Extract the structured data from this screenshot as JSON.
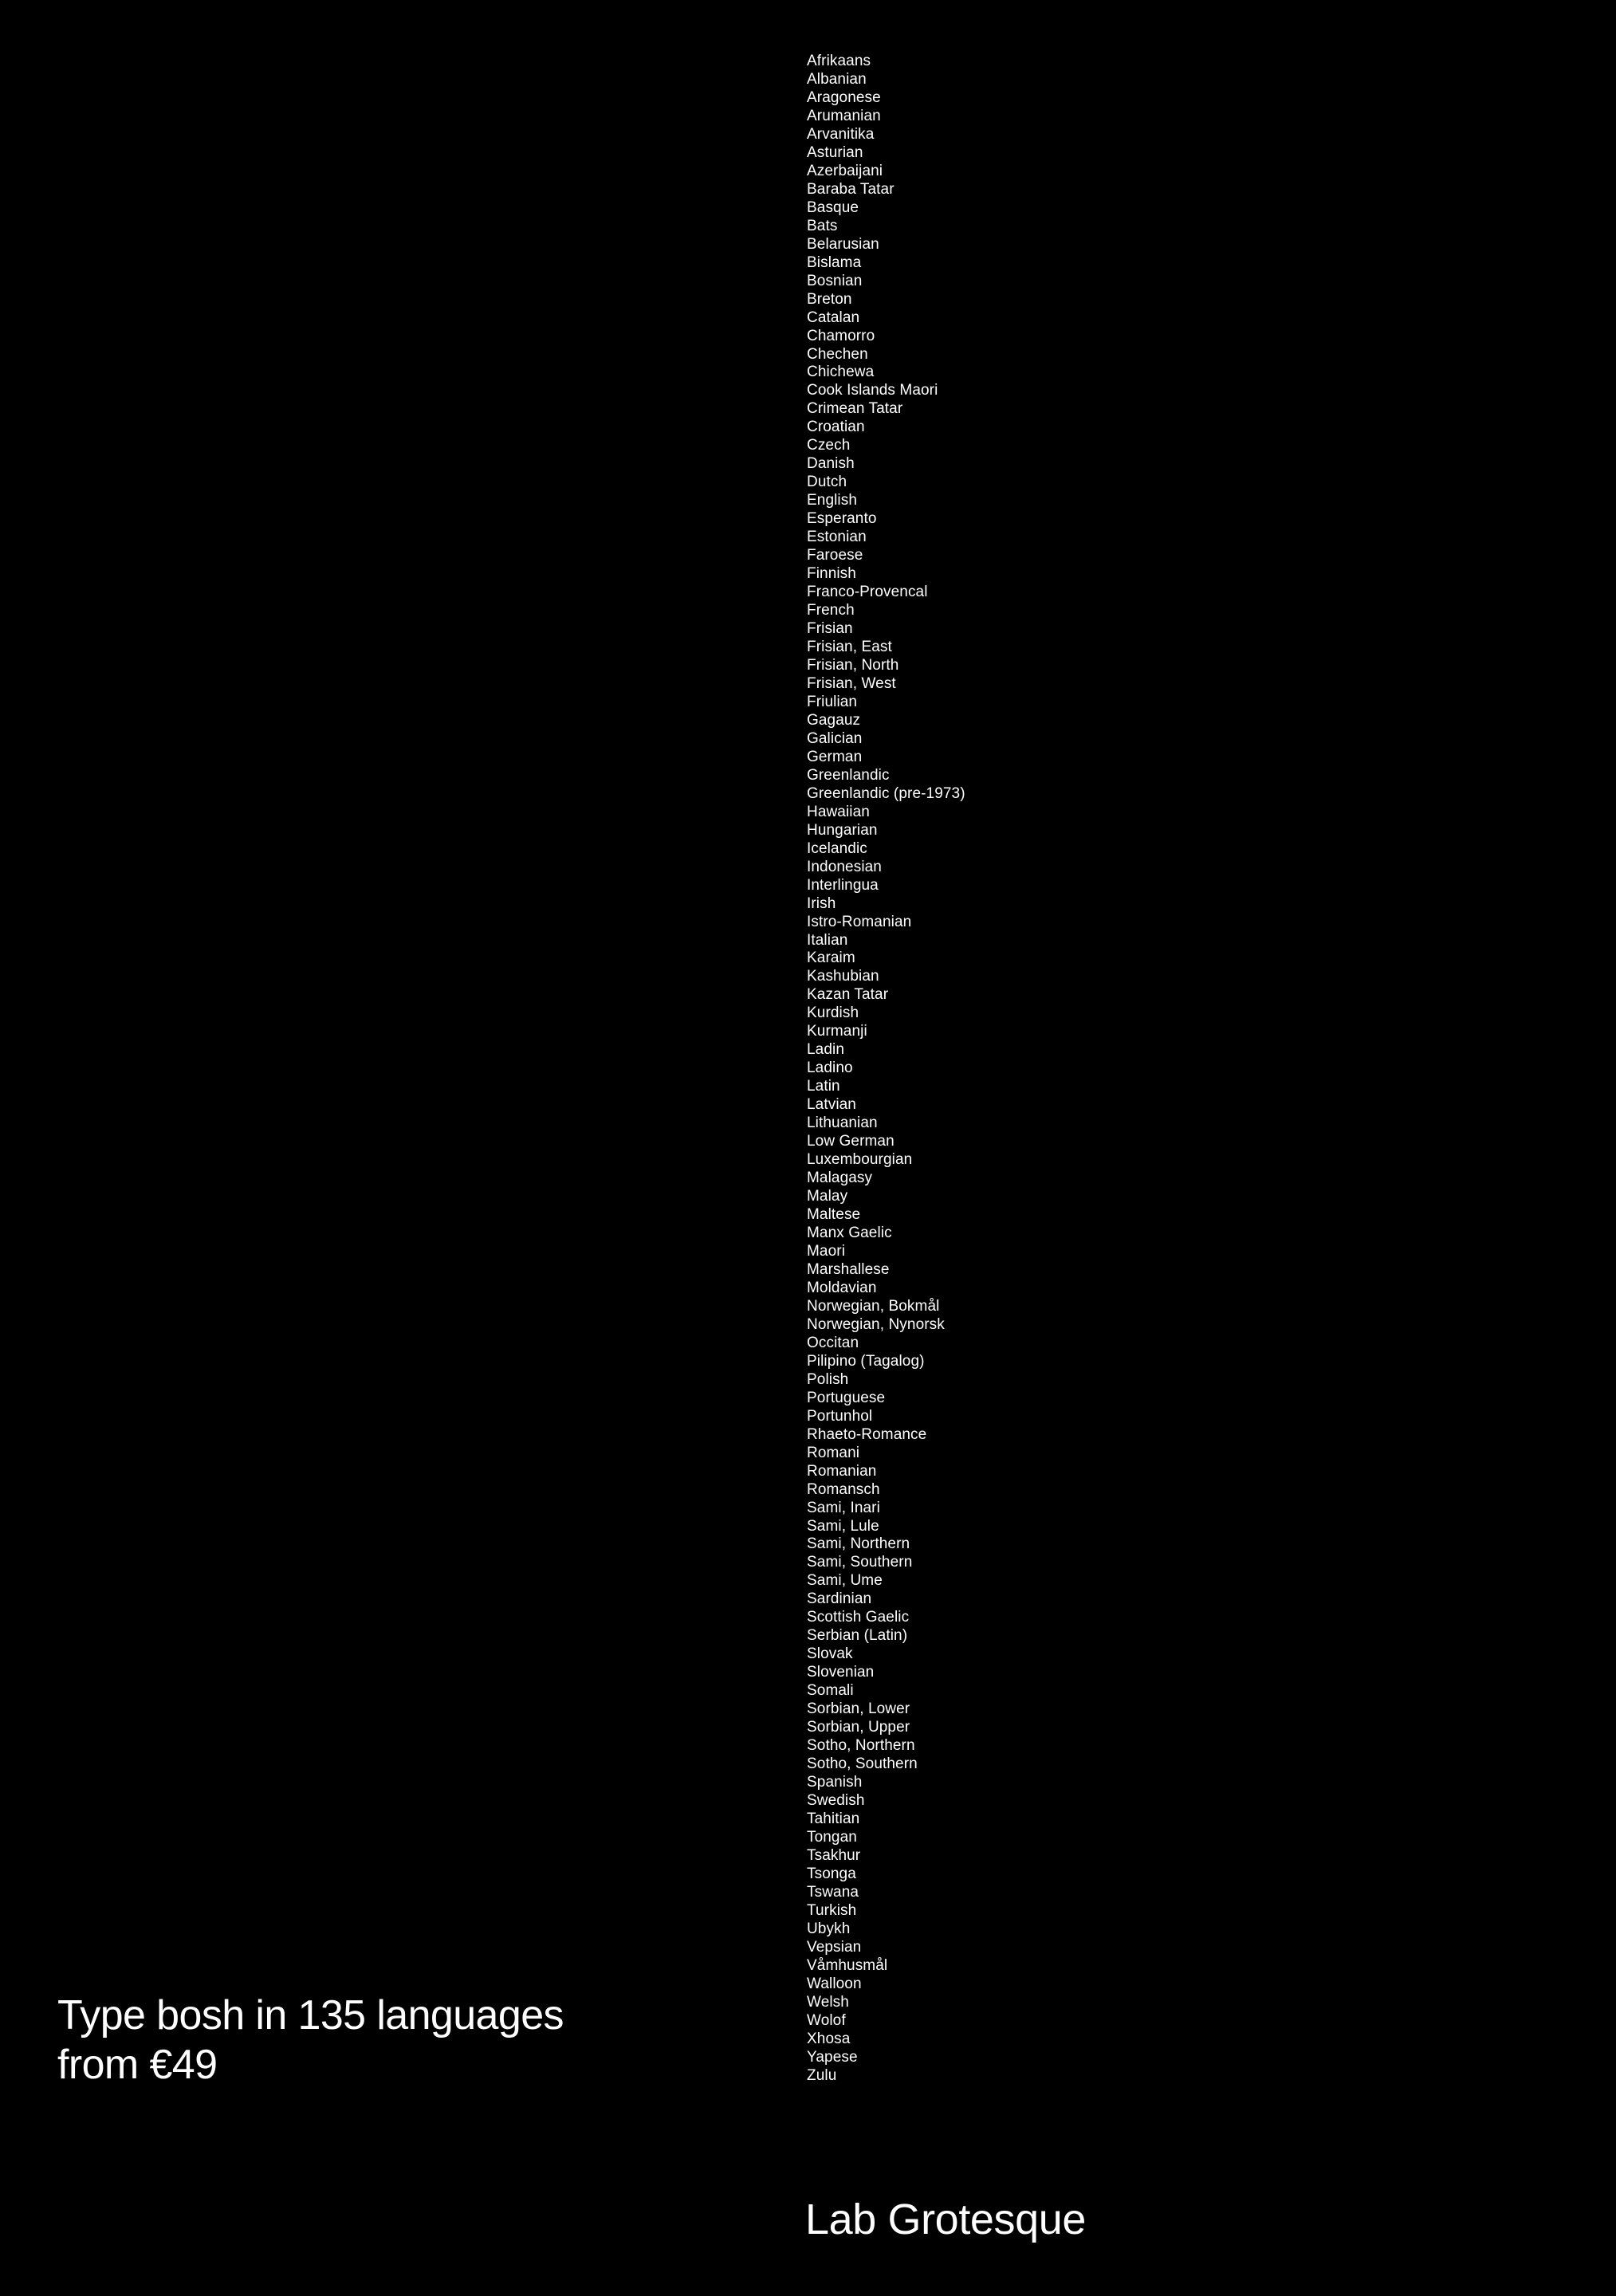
{
  "colors": {
    "background": "#000000",
    "text": "#ffffff"
  },
  "headline": {
    "line1": "Type bosh in 135 languages",
    "line2": "from €49"
  },
  "brand": {
    "name": "Lab Grotesque"
  },
  "languages": [
    "Afrikaans",
    "Albanian",
    "Aragonese",
    "Arumanian",
    "Arvanitika",
    "Asturian",
    "Azerbaijani",
    "Baraba Tatar",
    "Basque",
    "Bats",
    "Belarusian",
    "Bislama",
    "Bosnian",
    "Breton",
    "Catalan",
    "Chamorro",
    "Chechen",
    "Chichewa",
    "Cook Islands Maori",
    "Crimean Tatar",
    "Croatian",
    "Czech",
    "Danish",
    "Dutch",
    "English",
    "Esperanto",
    "Estonian",
    "Faroese",
    "Finnish",
    "Franco-Provencal",
    "French",
    "Frisian",
    "Frisian, East",
    "Frisian, North",
    "Frisian, West",
    "Friulian",
    "Gagauz",
    "Galician",
    "German",
    "Greenlandic",
    "Greenlandic (pre-1973)",
    "Hawaiian",
    "Hungarian",
    "Icelandic",
    "Indonesian",
    "Interlingua",
    "Irish",
    "Istro-Romanian",
    "Italian",
    "Karaim",
    "Kashubian",
    "Kazan Tatar",
    "Kurdish",
    "Kurmanji",
    "Ladin",
    "Ladino",
    "Latin",
    "Latvian",
    "Lithuanian",
    "Low German",
    "Luxembourgian",
    "Malagasy",
    "Malay",
    "Maltese",
    "Manx Gaelic",
    "Maori",
    "Marshallese",
    "Moldavian",
    "Norwegian, Bokmål",
    "Norwegian, Nynorsk",
    "Occitan",
    "Pilipino (Tagalog)",
    "Polish",
    "Portuguese",
    "Portunhol",
    "Rhaeto-Romance",
    "Romani",
    "Romanian",
    "Romansch",
    "Sami, Inari",
    "Sami, Lule",
    "Sami, Northern",
    "Sami, Southern",
    "Sami, Ume",
    "Sardinian",
    "Scottish Gaelic",
    "Serbian (Latin)",
    "Slovak",
    "Slovenian",
    "Somali",
    "Sorbian, Lower",
    "Sorbian, Upper",
    "Sotho, Northern",
    "Sotho, Southern",
    "Spanish",
    "Swedish",
    "Tahitian",
    "Tongan",
    "Tsakhur",
    "Tsonga",
    "Tswana",
    "Turkish",
    "Ubykh",
    "Vepsian",
    "Våmhusmål",
    "Walloon",
    "Welsh",
    "Wolof",
    "Xhosa",
    "Yapese",
    "Zulu"
  ]
}
